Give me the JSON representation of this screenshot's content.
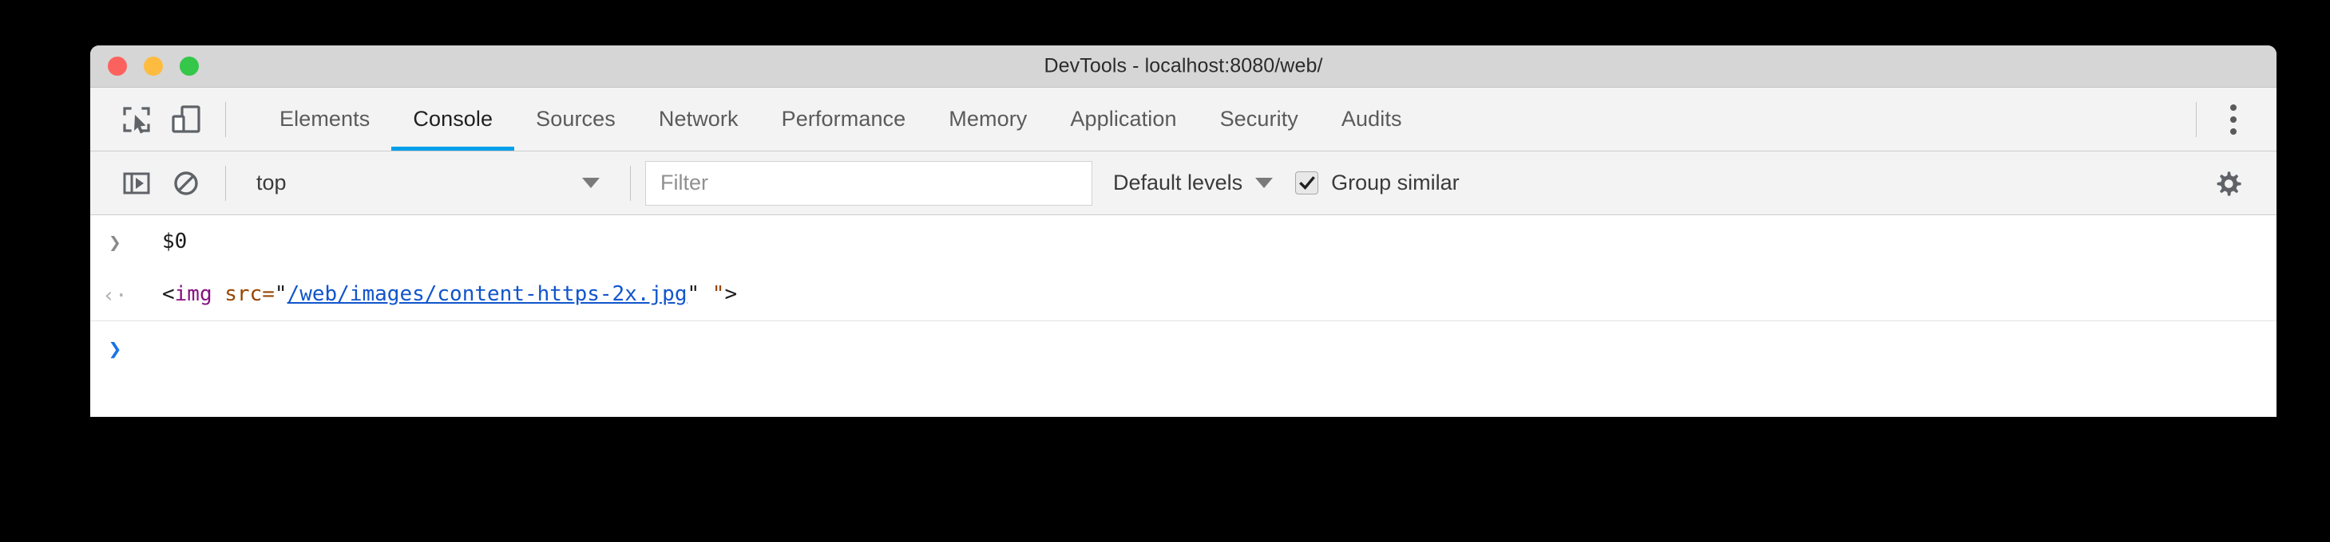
{
  "window": {
    "title": "DevTools - localhost:8080/web/",
    "traffic_lights": [
      {
        "name": "close",
        "color": "#fc625d"
      },
      {
        "name": "minimize",
        "color": "#fdbc40"
      },
      {
        "name": "maximize",
        "color": "#34c749"
      }
    ]
  },
  "toolbar": {
    "inspect_icon": "inspect-element-icon",
    "device_icon": "device-toolbar-icon",
    "kebab_icon": "more-options-icon"
  },
  "tabs": [
    {
      "label": "Elements",
      "active": false
    },
    {
      "label": "Console",
      "active": true
    },
    {
      "label": "Sources",
      "active": false
    },
    {
      "label": "Network",
      "active": false
    },
    {
      "label": "Performance",
      "active": false
    },
    {
      "label": "Memory",
      "active": false
    },
    {
      "label": "Application",
      "active": false
    },
    {
      "label": "Security",
      "active": false
    },
    {
      "label": "Audits",
      "active": false
    }
  ],
  "console_toolbar": {
    "sidebar_toggle_icon": "console-sidebar-icon",
    "clear_icon": "clear-console-icon",
    "context_value": "top",
    "filter_placeholder": "Filter",
    "filter_value": "",
    "levels_label": "Default levels",
    "group_similar_label": "Group similar",
    "group_similar_checked": true,
    "settings_icon": "gear-icon"
  },
  "console_log": {
    "input_glyph": "❯",
    "result_glyph": "‹·",
    "prompt_glyph": "❯",
    "input_command": "$0",
    "result_parts": {
      "open": "<",
      "tag": "img",
      "space": " ",
      "attr": "src",
      "eq": "=",
      "quote_open": "\"",
      "url": "/web/images/content-https-2x.jpg",
      "quote_close": "\"",
      "trailing": " \"",
      "close": ">"
    },
    "result_plain": "<img src=\"/web/images/content-https-2x.jpg\" \">"
  },
  "colors": {
    "accent_tab_underline": "#00a0e9",
    "titlebar_bg": "#d6d6d6",
    "toolbar_bg": "#f3f3f3",
    "console_bg": "#ffffff",
    "tag_color": "#881280",
    "attr_color": "#994500",
    "url_color": "#1155cc",
    "prompt_blue": "#1a73e8"
  }
}
